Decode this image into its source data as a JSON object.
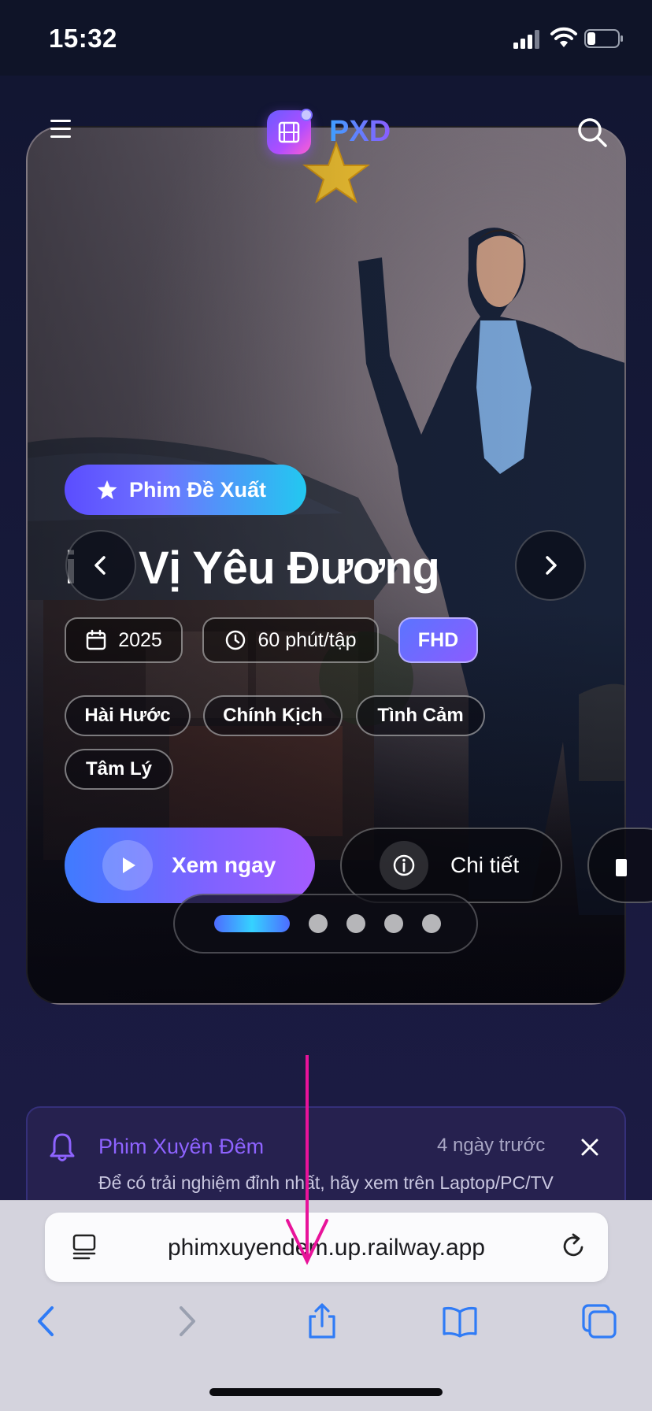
{
  "status_bar": {
    "time": "15:32"
  },
  "header": {
    "brand": "PXD"
  },
  "hero": {
    "badge": "Phim Đề Xuất",
    "title_prefix": "i",
    "title": "Vị Yêu Đương",
    "meta": {
      "year": "2025",
      "duration": "60 phút/tập",
      "quality": "FHD"
    },
    "genres": [
      "Hài Hước",
      "Chính Kịch",
      "Tình Cảm",
      "Tâm Lý"
    ],
    "play_label": "Xem ngay",
    "detail_label": "Chi tiết",
    "carousel": {
      "active_index": 0,
      "count": 5
    }
  },
  "notification": {
    "title": "Phim Xuyên Đêm",
    "time": "4 ngày trước",
    "body": "Để có trải nghiệm đỉnh nhất, hãy xem trên Laptop/PC/TV (Desktop)!"
  },
  "browser": {
    "url": "phimxuyendem.up.railway.app"
  },
  "colors": {
    "accent_purple": "#8b5cff",
    "accent_blue": "#3f7bff",
    "accent_cyan": "#22c8f0",
    "annotation_pink": "#e8139a",
    "safari_blue": "#2f7bf6"
  },
  "icons": {
    "menu": "menu-icon",
    "brand": "film-icon",
    "search": "search-icon",
    "badge": "star-icon",
    "prev": "chevron-left-icon",
    "next": "chevron-right-icon",
    "year": "calendar-icon",
    "duration": "clock-icon",
    "play": "play-icon",
    "detail": "info-icon",
    "bell": "bell-icon",
    "close": "close-icon",
    "reader": "reader-icon",
    "reload": "reload-icon",
    "share": "share-icon",
    "bookmarks": "book-icon",
    "tabs": "tabs-icon",
    "back": "back-icon",
    "forward": "forward-icon"
  }
}
